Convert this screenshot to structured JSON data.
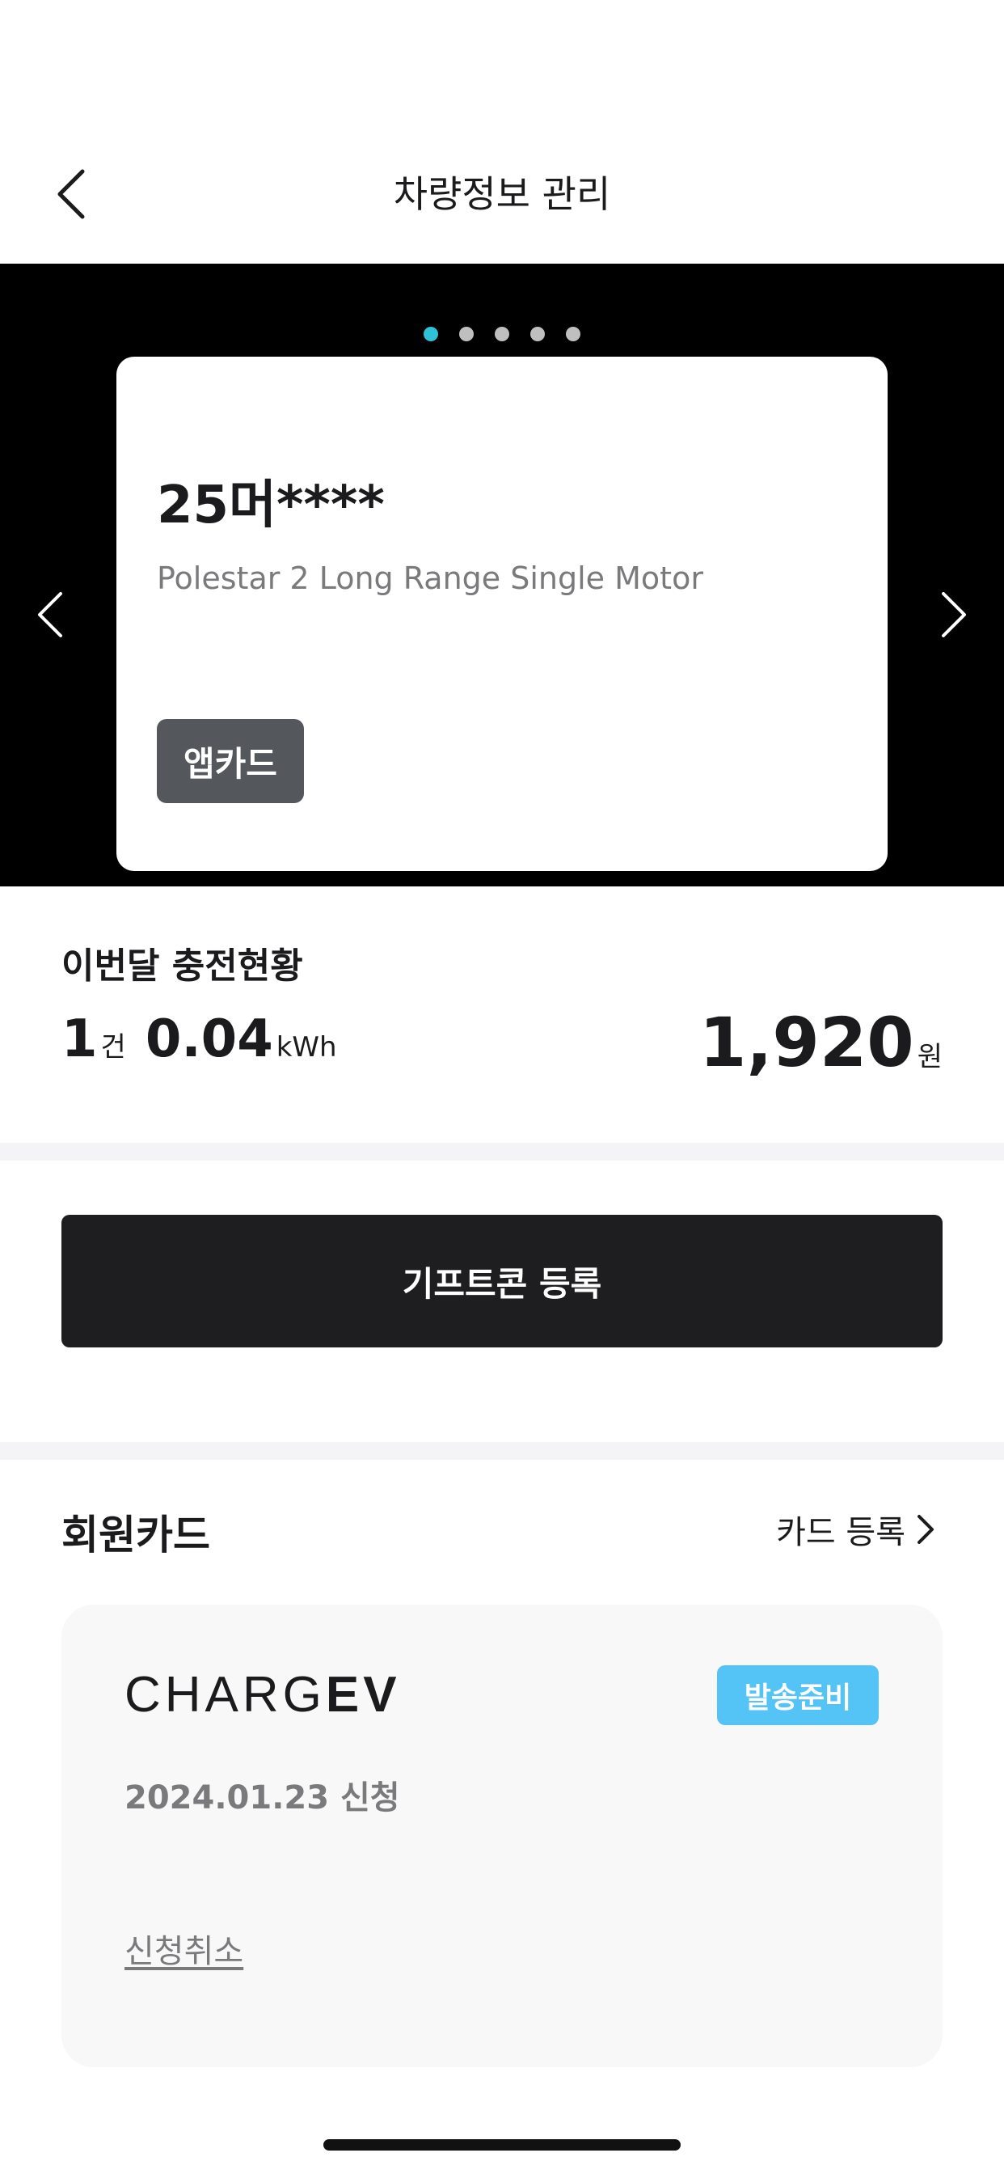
{
  "header": {
    "title": "차량정보 관리",
    "back_icon": "chevron-left-icon"
  },
  "carousel": {
    "page_count": 5,
    "active_index": 0,
    "active_color": "#2fc1d6",
    "vehicle": {
      "plate": "25머****",
      "model": "Polestar 2 Long Range Single Motor",
      "badge": "앱카드"
    }
  },
  "monthly": {
    "title": "이번달 충전현황",
    "count": "1",
    "count_unit": "건",
    "energy": "0.04",
    "energy_unit": "kWh",
    "amount": "1,920",
    "amount_unit": "원"
  },
  "gifticon_button": {
    "label": "기프트콘 등록"
  },
  "member_card": {
    "title": "회원카드",
    "register_label": "카드 등록",
    "brand_light": "CHARG",
    "brand_bold": "EV",
    "status": "발송준비",
    "status_color": "#54c3f6",
    "apply_date": "2024.01.23 신청",
    "cancel_label": "신청취소"
  }
}
